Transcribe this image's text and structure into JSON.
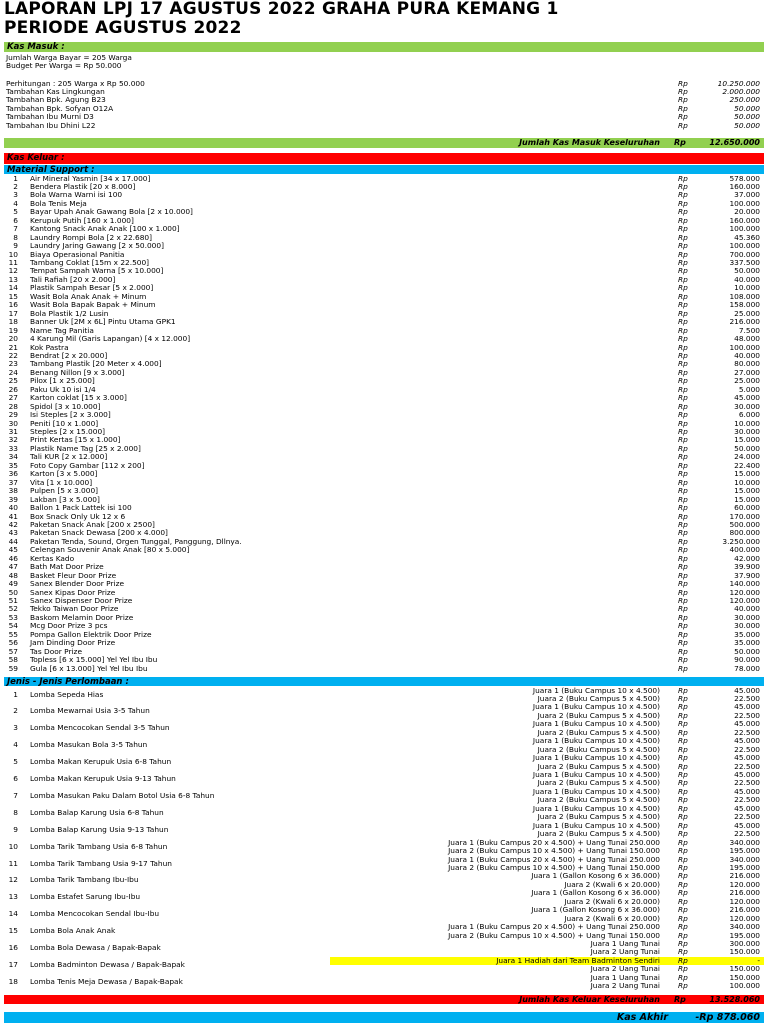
{
  "title_line1": "LAPORAN LPJ 17 AGUSTUS 2022 GRAHA PURA KEMANG 1",
  "title_line2": "PERIODE AGUSTUS 2022",
  "kas_masuk": {
    "header": "Kas Masuk :",
    "info": [
      "Jumlah Warga Bayar = 205 Warga",
      "Budget Per Warga = Rp 50.000"
    ],
    "items": [
      {
        "label": "Perhitungan : 205 Warga x Rp 50.000",
        "cur": "Rp",
        "amount": "10.250.000"
      },
      {
        "label": "Tambahan Kas Lingkungan",
        "cur": "Rp",
        "amount": "2.000.000"
      },
      {
        "label": "Tambahan Bpk. Agung B23",
        "cur": "Rp",
        "amount": "250.000"
      },
      {
        "label": "Tambahan Bpk. Sofyan O12A",
        "cur": "Rp",
        "amount": "50.000"
      },
      {
        "label": "Tambahan Ibu Murni D3",
        "cur": "Rp",
        "amount": "50.000"
      },
      {
        "label": "Tambahan Ibu Dhini L22",
        "cur": "Rp",
        "amount": "50.000"
      }
    ],
    "total_label": "Jumlah Kas Masuk Keseluruhan",
    "total_cur": "Rp",
    "total_amount": "12.650.000"
  },
  "kas_keluar": {
    "header": "Kas Keluar :",
    "material_header": "Material Support :",
    "materials": [
      {
        "no": "1",
        "name": "Air Mineral Yasmin [34 x 17.000]",
        "amount": "578.000"
      },
      {
        "no": "2",
        "name": "Bendera Plastik [20 x 8.000]",
        "amount": "160.000"
      },
      {
        "no": "3",
        "name": "Bola Warna Warni isi 100",
        "amount": "37.000"
      },
      {
        "no": "4",
        "name": "Bola Tenis Meja",
        "amount": "100.000"
      },
      {
        "no": "5",
        "name": "Bayar Upah Anak Gawang Bola [2 x 10.000]",
        "amount": "20.000"
      },
      {
        "no": "6",
        "name": "Kerupuk Putih [160 x 1.000]",
        "amount": "160.000"
      },
      {
        "no": "7",
        "name": "Kantong Snack Anak Anak [100 x 1.000]",
        "amount": "100.000"
      },
      {
        "no": "8",
        "name": "Laundry Rompi Bola [2 x 22.680]",
        "amount": "45.360"
      },
      {
        "no": "9",
        "name": "Laundry Jaring Gawang [2 x 50.000]",
        "amount": "100.000"
      },
      {
        "no": "10",
        "name": "Biaya Operasional Panitia",
        "amount": "700.000"
      },
      {
        "no": "11",
        "name": "Tambang Coklat [15m x 22.500]",
        "amount": "337.500"
      },
      {
        "no": "12",
        "name": "Tempat Sampah Warna [5 x 10.000]",
        "amount": "50.000"
      },
      {
        "no": "13",
        "name": "Tali Rafiah [20 x 2.000]",
        "amount": "40.000"
      },
      {
        "no": "14",
        "name": "Plastik Sampah Besar [5 x 2.000]",
        "amount": "10.000"
      },
      {
        "no": "15",
        "name": "Wasit Bola Anak Anak + Minum",
        "amount": "108.000"
      },
      {
        "no": "16",
        "name": "Wasit Bola Bapak Bapak + Minum",
        "amount": "158.000"
      },
      {
        "no": "17",
        "name": "Bola Plastik 1/2 Lusin",
        "amount": "25.000"
      },
      {
        "no": "18",
        "name": "Banner Uk [2M x 6L] Pintu Utama GPK1",
        "amount": "216.000"
      },
      {
        "no": "19",
        "name": "Name Tag Panitia",
        "amount": "7.500"
      },
      {
        "no": "20",
        "name": "4 Karung Mil (Garis Lapangan) [4 x 12.000]",
        "amount": "48.000"
      },
      {
        "no": "21",
        "name": "Kok Pastra",
        "amount": "100.000"
      },
      {
        "no": "22",
        "name": "Bendrat [2 x 20.000]",
        "amount": "40.000"
      },
      {
        "no": "23",
        "name": "Tambang Plastik [20 Meter x 4.000]",
        "amount": "80.000"
      },
      {
        "no": "24",
        "name": "Benang Nillon [9 x 3.000]",
        "amount": "27.000"
      },
      {
        "no": "25",
        "name": "Pilox [1 x 25.000]",
        "amount": "25.000"
      },
      {
        "no": "26",
        "name": "Paku Uk 10 isi 1/4",
        "amount": "5.000"
      },
      {
        "no": "27",
        "name": "Karton coklat [15 x 3.000]",
        "amount": "45.000"
      },
      {
        "no": "28",
        "name": "Spidol [3 x 10.000]",
        "amount": "30.000"
      },
      {
        "no": "29",
        "name": "Isi Steples [2 x 3.000]",
        "amount": "6.000"
      },
      {
        "no": "30",
        "name": "Peniti [10 x 1.000]",
        "amount": "10.000"
      },
      {
        "no": "31",
        "name": "Steples [2 x 15.000]",
        "amount": "30.000"
      },
      {
        "no": "32",
        "name": "Print Kertas [15 x 1.000]",
        "amount": "15.000"
      },
      {
        "no": "33",
        "name": "Plastik Name Tag [25 x 2.000]",
        "amount": "50.000"
      },
      {
        "no": "34",
        "name": "Tali KUR [2 x 12.000]",
        "amount": "24.000"
      },
      {
        "no": "35",
        "name": "Foto Copy Gambar [112 x 200]",
        "amount": "22.400"
      },
      {
        "no": "36",
        "name": "Karton [3 x 5.000]",
        "amount": "15.000"
      },
      {
        "no": "37",
        "name": "Vita [1 x 10.000]",
        "amount": "10.000"
      },
      {
        "no": "38",
        "name": "Pulpen [5 x 3.000]",
        "amount": "15.000"
      },
      {
        "no": "39",
        "name": "Lakban [3 x 5.000]",
        "amount": "15.000"
      },
      {
        "no": "40",
        "name": "Ballon 1 Pack Lattek isi 100",
        "amount": "60.000"
      },
      {
        "no": "41",
        "name": "Box Snack Only Uk 12 x 6",
        "amount": "170.000"
      },
      {
        "no": "42",
        "name": "Paketan Snack Anak [200 x 2500]",
        "amount": "500.000"
      },
      {
        "no": "43",
        "name": "Paketan Snack Dewasa [200 x 4.000]",
        "amount": "800.000"
      },
      {
        "no": "44",
        "name": "Paketan Tenda, Sound, Orgen Tunggal, Panggung, Dllnya.",
        "amount": "3.250.000"
      },
      {
        "no": "45",
        "name": "Celengan Souvenir Anak Anak [80 x 5.000]",
        "amount": "400.000"
      },
      {
        "no": "46",
        "name": "Kertas Kado",
        "amount": "42.000"
      },
      {
        "no": "47",
        "name": "Bath Mat Door Prize",
        "amount": "39.900"
      },
      {
        "no": "48",
        "name": "Basket Fleur Door Prize",
        "amount": "37.900"
      },
      {
        "no": "49",
        "name": "Sanex Blender Door Prize",
        "amount": "140.000"
      },
      {
        "no": "50",
        "name": "Sanex Kipas Door Prize",
        "amount": "120.000"
      },
      {
        "no": "51",
        "name": "Sanex Dispenser Door Prize",
        "amount": "120.000"
      },
      {
        "no": "52",
        "name": "Tekko Taiwan Door Prize",
        "amount": "40.000"
      },
      {
        "no": "53",
        "name": "Baskom Melamin Door Prize",
        "amount": "30.000"
      },
      {
        "no": "54",
        "name": "Mcg Door Prize 3 pcs",
        "amount": "30.000"
      },
      {
        "no": "55",
        "name": "Pompa Gallon Elektrik Door Prize",
        "amount": "35.000"
      },
      {
        "no": "56",
        "name": "Jam Dinding Door Prize",
        "amount": "35.000"
      },
      {
        "no": "57",
        "name": "Tas Door Prize",
        "amount": "50.000"
      },
      {
        "no": "58",
        "name": "Topless [6 x 15.000] Yel Yel Ibu Ibu",
        "amount": "90.000"
      },
      {
        "no": "59",
        "name": "Gula [6 x 13.000] Yel Yel Ibu Ibu",
        "amount": "78.000"
      }
    ],
    "lomba_header": "Jenis - Jenis Perlombaan :",
    "lomba": [
      {
        "no": "1",
        "name": "Lomba Sepeda Hias",
        "prize": "Juara 1 (Buku Campus 10 x 4.500)",
        "amount": "45.000"
      },
      {
        "no": "",
        "name": "",
        "prize": "Juara 2 (Buku Campus 5 x 4.500)",
        "amount": "22.500"
      },
      {
        "no": "2",
        "name": "Lomba Mewarnai Usia 3-5 Tahun",
        "prize": "Juara 1 (Buku Campus 10 x 4.500)",
        "amount": "45.000"
      },
      {
        "no": "",
        "name": "",
        "prize": "Juara 2 (Buku Campus 5 x 4.500)",
        "amount": "22.500"
      },
      {
        "no": "3",
        "name": "Lomba Mencocokan Sendal 3-5 Tahun",
        "prize": "Juara 1 (Buku Campus 10 x 4.500)",
        "amount": "45.000"
      },
      {
        "no": "",
        "name": "",
        "prize": "Juara 2 (Buku Campus 5 x 4.500)",
        "amount": "22.500"
      },
      {
        "no": "4",
        "name": "Lomba Masukan Bola 3-5 Tahun",
        "prize": "Juara 1 (Buku Campus 10 x 4.500)",
        "amount": "45.000"
      },
      {
        "no": "",
        "name": "",
        "prize": "Juara 2 (Buku Campus 5 x 4.500)",
        "amount": "22.500"
      },
      {
        "no": "5",
        "name": "Lomba Makan Kerupuk Usia 6-8 Tahun",
        "prize": "Juara 1 (Buku Campus 10 x 4.500)",
        "amount": "45.000"
      },
      {
        "no": "",
        "name": "",
        "prize": "Juara 2 (Buku Campus 5 x 4.500)",
        "amount": "22.500"
      },
      {
        "no": "6",
        "name": "Lomba Makan Kerupuk Usia 9-13 Tahun",
        "prize": "Juara 1 (Buku Campus 10 x 4.500)",
        "amount": "45.000"
      },
      {
        "no": "",
        "name": "",
        "prize": "Juara 2 (Buku Campus 5 x 4.500)",
        "amount": "22.500"
      },
      {
        "no": "7",
        "name": "Lomba Masukan Paku Dalam Botol Usia 6-8 Tahun",
        "prize": "Juara 1 (Buku Campus 10 x 4.500)",
        "amount": "45.000"
      },
      {
        "no": "",
        "name": "",
        "prize": "Juara 2 (Buku Campus 5 x 4.500)",
        "amount": "22.500"
      },
      {
        "no": "8",
        "name": "Lomba Balap Karung Usia 6-8 Tahun",
        "prize": "Juara 1 (Buku Campus 10 x 4.500)",
        "amount": "45.000"
      },
      {
        "no": "",
        "name": "",
        "prize": "Juara 2 (Buku Campus 5 x 4.500)",
        "amount": "22.500"
      },
      {
        "no": "9",
        "name": "Lomba Balap Karung Usia 9-13 Tahun",
        "prize": "Juara 1 (Buku Campus 10 x 4.500)",
        "amount": "45.000"
      },
      {
        "no": "",
        "name": "",
        "prize": "Juara 2 (Buku Campus 5 x 4.500)",
        "amount": "22.500"
      },
      {
        "no": "10",
        "name": "Lomba Tarik Tambang Usia 6-8 Tahun",
        "prize": "Juara 1 (Buku Campus 20 x 4.500) + Uang Tunai 250.000",
        "amount": "340.000"
      },
      {
        "no": "",
        "name": "",
        "prize": "Juara 2 (Buku Campus 10 x 4.500) + Uang Tunai 150.000",
        "amount": "195.000"
      },
      {
        "no": "11",
        "name": "Lomba Tarik Tambang Usia 9-17 Tahun",
        "prize": "Juara 1 (Buku Campus 20 x 4.500) + Uang Tunai 250.000",
        "amount": "340.000"
      },
      {
        "no": "",
        "name": "",
        "prize": "Juara 2 (Buku Campus 10 x 4.500) + Uang Tunai 150.000",
        "amount": "195.000"
      },
      {
        "no": "12",
        "name": "Lomba Tarik Tambang Ibu-Ibu",
        "prize": "Juara 1 (Gallon Kosong 6 x 36.000)",
        "amount": "216.000"
      },
      {
        "no": "",
        "name": "",
        "prize": "Juara 2 (Kwali  6 x 20.000)",
        "amount": "120.000"
      },
      {
        "no": "13",
        "name": "Lomba Estafet Sarung Ibu-Ibu",
        "prize": "Juara 1 (Gallon Kosong 6 x 36.000)",
        "amount": "216.000"
      },
      {
        "no": "",
        "name": "",
        "prize": "Juara 2 (Kwali  6 x 20.000)",
        "amount": "120.000"
      },
      {
        "no": "14",
        "name": "Lomba Mencocokan Sendal Ibu-Ibu",
        "prize": "Juara 1 (Gallon Kosong 6 x 36.000)",
        "amount": "216.000"
      },
      {
        "no": "",
        "name": "",
        "prize": "Juara 2 (Kwali  6 x 20.000)",
        "amount": "120.000"
      },
      {
        "no": "15",
        "name": "Lomba Bola Anak Anak",
        "prize": "Juara 1 (Buku Campus 20 x 4.500) + Uang Tunai 250.000",
        "amount": "340.000"
      },
      {
        "no": "",
        "name": "",
        "prize": "Juara 2 (Buku Campus 10 x 4.500) + Uang Tunai 150.000",
        "amount": "195.000"
      },
      {
        "no": "16",
        "name": "Lomba Bola Dewasa / Bapak-Bapak",
        "prize": "Juara 1 Uang Tunai",
        "amount": "300.000"
      },
      {
        "no": "",
        "name": "",
        "prize": "Juara 2 Uang Tunai",
        "amount": "150.000"
      },
      {
        "no": "17",
        "name": "Lomba Badminton Dewasa / Bapak-Bapak",
        "prize": "Juara 1 Hadiah dari Team Badminton Sendiri",
        "amount": "-",
        "highlight": true
      },
      {
        "no": "",
        "name": "",
        "prize": "Juara 2 Uang Tunai",
        "amount": "150.000"
      },
      {
        "no": "18",
        "name": "Lomba Tenis Meja Dewasa / Bapak-Bapak",
        "prize": "Juara 1 Uang Tunai",
        "amount": "150.000"
      },
      {
        "no": "",
        "name": "",
        "prize": "Juara 2 Uang Tunai",
        "amount": "100.000"
      }
    ],
    "total_label": "Jumlah Kas Keluar Keseluruhan",
    "total_cur": "Rp",
    "total_amount": "13.528.060"
  },
  "kas_akhir": {
    "label": "Kas Akhir",
    "amount": "-Rp 878.060"
  },
  "currency": "Rp",
  "colors": {
    "green": "#92d050",
    "red": "#ff0000",
    "blue": "#00b0f0",
    "yellow": "#ffff00"
  }
}
